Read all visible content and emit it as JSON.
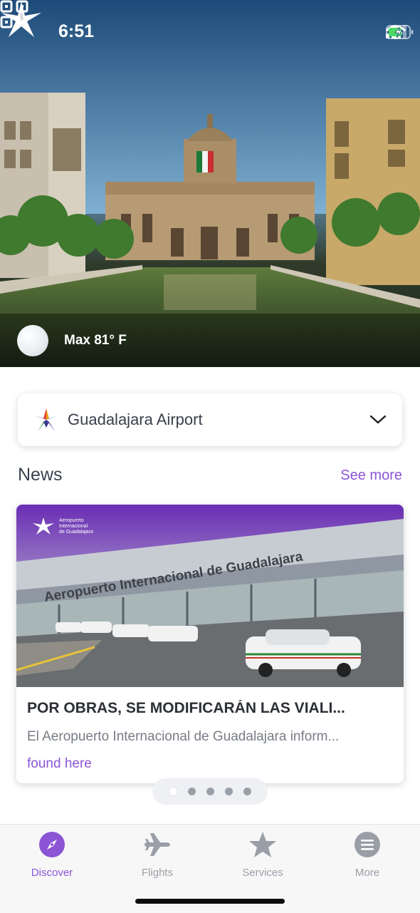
{
  "status_bar": {
    "time": "6:51"
  },
  "weather": {
    "icon": "moon-icon",
    "text": "Max 81° F"
  },
  "airport_selector": {
    "name": "Guadalajara Airport"
  },
  "news": {
    "title": "News",
    "see_more": "See more",
    "card": {
      "image_logo_line1": "Aeropuerto",
      "image_logo_line2": "Internacional",
      "image_logo_line3": "de Guadalajara",
      "image_sign": "Aeropuerto Internacional de Guadalajara",
      "headline": "POR OBRAS, SE MODIFICARÁN LAS VIALI...",
      "summary": "El Aeropuerto Internacional de Guadalajara inform...",
      "link": "found here"
    },
    "pagination": {
      "count": 5,
      "active": 0
    }
  },
  "tabs": [
    {
      "label": "Discover",
      "icon": "compass-icon",
      "active": true
    },
    {
      "label": "Flights",
      "icon": "airplane-icon",
      "active": false
    },
    {
      "label": "Services",
      "icon": "star-icon",
      "active": false
    },
    {
      "label": "More",
      "icon": "menu-icon",
      "active": false
    }
  ],
  "colors": {
    "accent": "#8b55d6",
    "text_dark": "#3b4250",
    "muted": "#9a9ea6"
  }
}
